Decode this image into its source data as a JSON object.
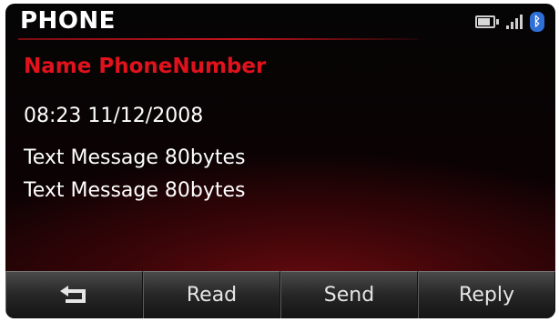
{
  "header": {
    "title": "PHONE"
  },
  "status": {
    "icons": [
      "battery-icon",
      "signal-icon",
      "bluetooth-icon"
    ],
    "bluetooth_glyph": "ᛒ"
  },
  "message": {
    "sender": "Name PhoneNumber",
    "timestamp": "08:23 11/12/2008",
    "lines": [
      "Text Message 80bytes",
      "Text Message 80bytes"
    ]
  },
  "buttons": {
    "back_icon": "back-arrow-icon",
    "read_label": "Read",
    "send_label": "Send",
    "reply_label": "Reply"
  },
  "colors": {
    "sender": "#e0121c",
    "accent": "#c8141c",
    "bluetooth": "#2f6fd6"
  }
}
